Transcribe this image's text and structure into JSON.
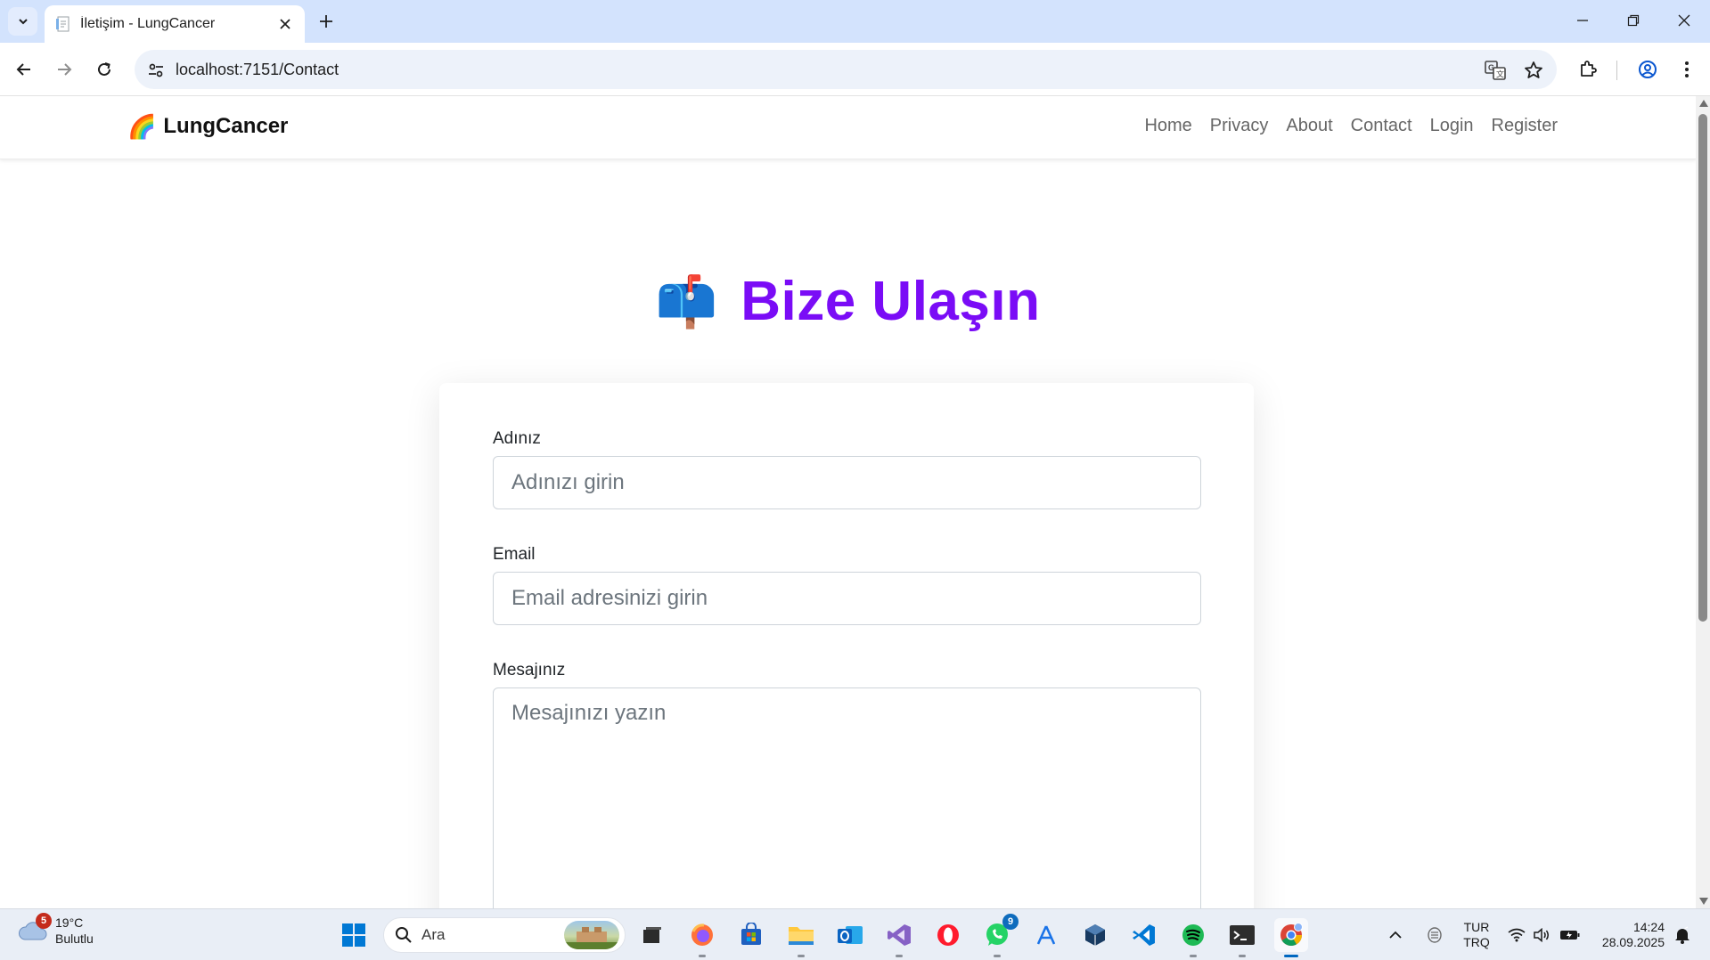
{
  "browser": {
    "tab_title": "İletişim - LungCancer",
    "url": "localhost:7151/Contact"
  },
  "site": {
    "brand_logo": "🌈",
    "brand_name": "LungCancer",
    "nav": [
      "Home",
      "Privacy",
      "About",
      "Contact",
      "Login",
      "Register"
    ]
  },
  "page": {
    "heading_icon": "📫",
    "heading": "Bize Ulaşın",
    "heading_color": "#7a0cf6"
  },
  "form": {
    "name_label": "Adınız",
    "name_placeholder": "Adınızı girin",
    "name_value": "",
    "email_label": "Email",
    "email_placeholder": "Email adresinizi girin",
    "email_value": "",
    "message_label": "Mesajınız",
    "message_placeholder": "Mesajınızı yazın",
    "message_value": ""
  },
  "taskbar": {
    "weather_badge": "5",
    "weather_temp": "19°C",
    "weather_desc": "Bulutlu",
    "search_label": "Ara",
    "whatsapp_badge": "9",
    "lang_line1": "TUR",
    "lang_line2": "TRQ",
    "time": "14:24",
    "date": "28.09.2025"
  }
}
